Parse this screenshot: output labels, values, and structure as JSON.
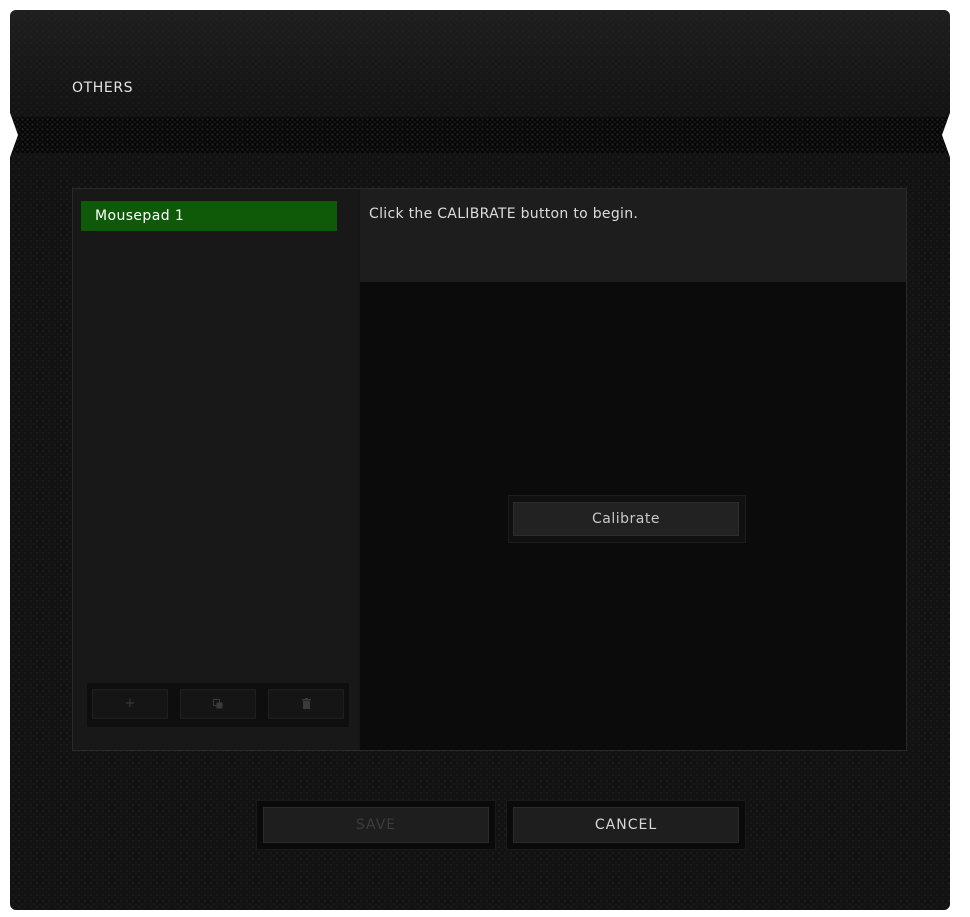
{
  "window": {
    "title": "OTHERS"
  },
  "profiles": {
    "items": [
      {
        "label": "Mousepad 1",
        "selected": true
      }
    ],
    "actions": {
      "add_icon": "plus-icon",
      "copy_icon": "copy-icon",
      "delete_icon": "trash-icon"
    }
  },
  "main": {
    "instruction": "Click the CALIBRATE button to begin.",
    "calibrate_label": "Calibrate"
  },
  "footer": {
    "save_label": "SAVE",
    "cancel_label": "CANCEL",
    "save_enabled": false
  },
  "colors": {
    "accent_green": "#0f5a08",
    "background": "#121212"
  }
}
